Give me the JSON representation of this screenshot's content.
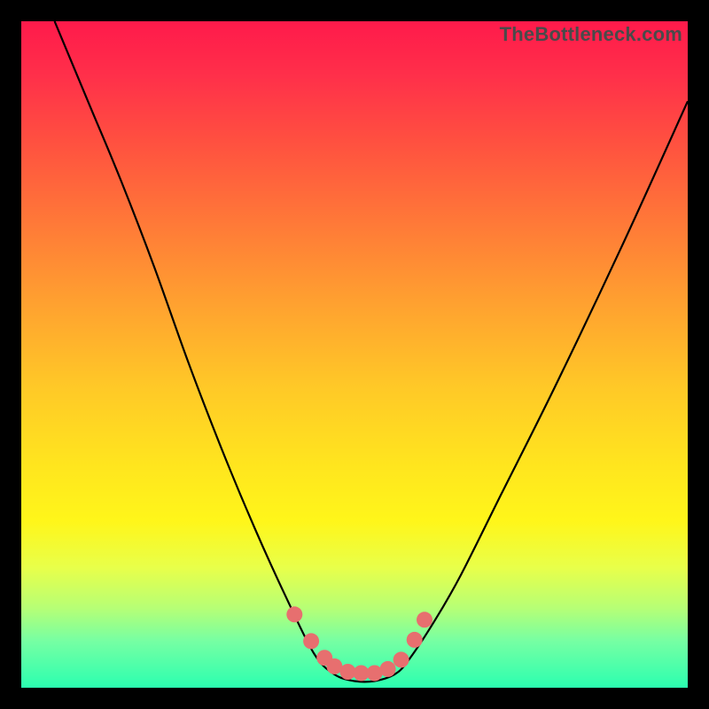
{
  "watermark": {
    "text": "TheBottleneck.com"
  },
  "chart_data": {
    "type": "line",
    "title": "",
    "xlabel": "",
    "ylabel": "",
    "xlim": [
      0,
      100
    ],
    "ylim": [
      0,
      100
    ],
    "series": [
      {
        "name": "bottleneck-curve",
        "x": [
          5,
          10,
          15,
          20,
          25,
          30,
          35,
          40,
          44,
          47,
          50,
          53,
          56,
          58,
          62,
          66,
          72,
          80,
          90,
          100
        ],
        "values": [
          100,
          88,
          76,
          63,
          49,
          36,
          24,
          13,
          5,
          2,
          1,
          1,
          2,
          4,
          10,
          17,
          29,
          45,
          66,
          88
        ]
      }
    ],
    "markers": {
      "name": "highlight-dots",
      "x": [
        41,
        43.5,
        45.5,
        47,
        49,
        51,
        53,
        55,
        57,
        59,
        60.5
      ],
      "values": [
        11,
        7,
        4.5,
        3.2,
        2.4,
        2.2,
        2.2,
        2.8,
        4.2,
        7.2,
        10.2
      ]
    },
    "gradient_stops": [
      {
        "pos": 0,
        "color": "#ff1a4b"
      },
      {
        "pos": 18,
        "color": "#ff5040"
      },
      {
        "pos": 42,
        "color": "#ffa030"
      },
      {
        "pos": 67,
        "color": "#ffe61e"
      },
      {
        "pos": 88,
        "color": "#b7ff75"
      },
      {
        "pos": 100,
        "color": "#2bffb0"
      }
    ]
  }
}
